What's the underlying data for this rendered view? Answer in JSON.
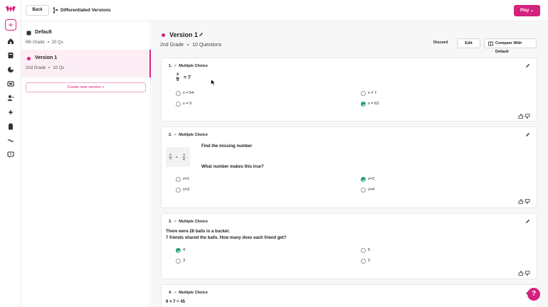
{
  "topbar": {
    "back_label": "Back",
    "breadcrumb_title": "Differentiated Versions",
    "play_label": "Play"
  },
  "colors": {
    "accent": "#d3237d",
    "correct": "#21a16f"
  },
  "versions": [
    {
      "title": "Default",
      "grade": "6th Grade",
      "count": "20 Qs"
    },
    {
      "title": "Version 1",
      "grade": "2nd Grade",
      "count": "10 Qs"
    }
  ],
  "create_label": "Create new version +",
  "header": {
    "title": "Version 1",
    "grade": "2nd Grade",
    "count": "10 Questions",
    "discard_label": "Discard",
    "edit_label": "Edit",
    "compare_label": "Compare With Default"
  },
  "questions": [
    {
      "number": "1.",
      "type": "Multiple Choice",
      "math": {
        "num": "x",
        "den": "9",
        "rhs": "= 7"
      },
      "options": [
        "x = 54",
        "x = 7",
        "x = 9",
        "x = 63"
      ],
      "correct_index": 3
    },
    {
      "number": "2.",
      "type": "Multiple Choice",
      "text1": "Find the missing number",
      "text2": "What number makes this true?",
      "options": [
        "x=1",
        "x=2",
        "x=3",
        "x=4"
      ],
      "correct_index": 1
    },
    {
      "number": "3.",
      "type": "Multiple Choice",
      "text1": "There were 28 balls in a bucket.",
      "text2": "7 friends shared the balls. How many does each friend get?",
      "options": [
        "4",
        "5",
        "3",
        "2"
      ],
      "correct_index": 0
    },
    {
      "number": "4.",
      "type": "Multiple Choice",
      "text1": "9 × 7 = 45"
    }
  ],
  "help_label": "?"
}
